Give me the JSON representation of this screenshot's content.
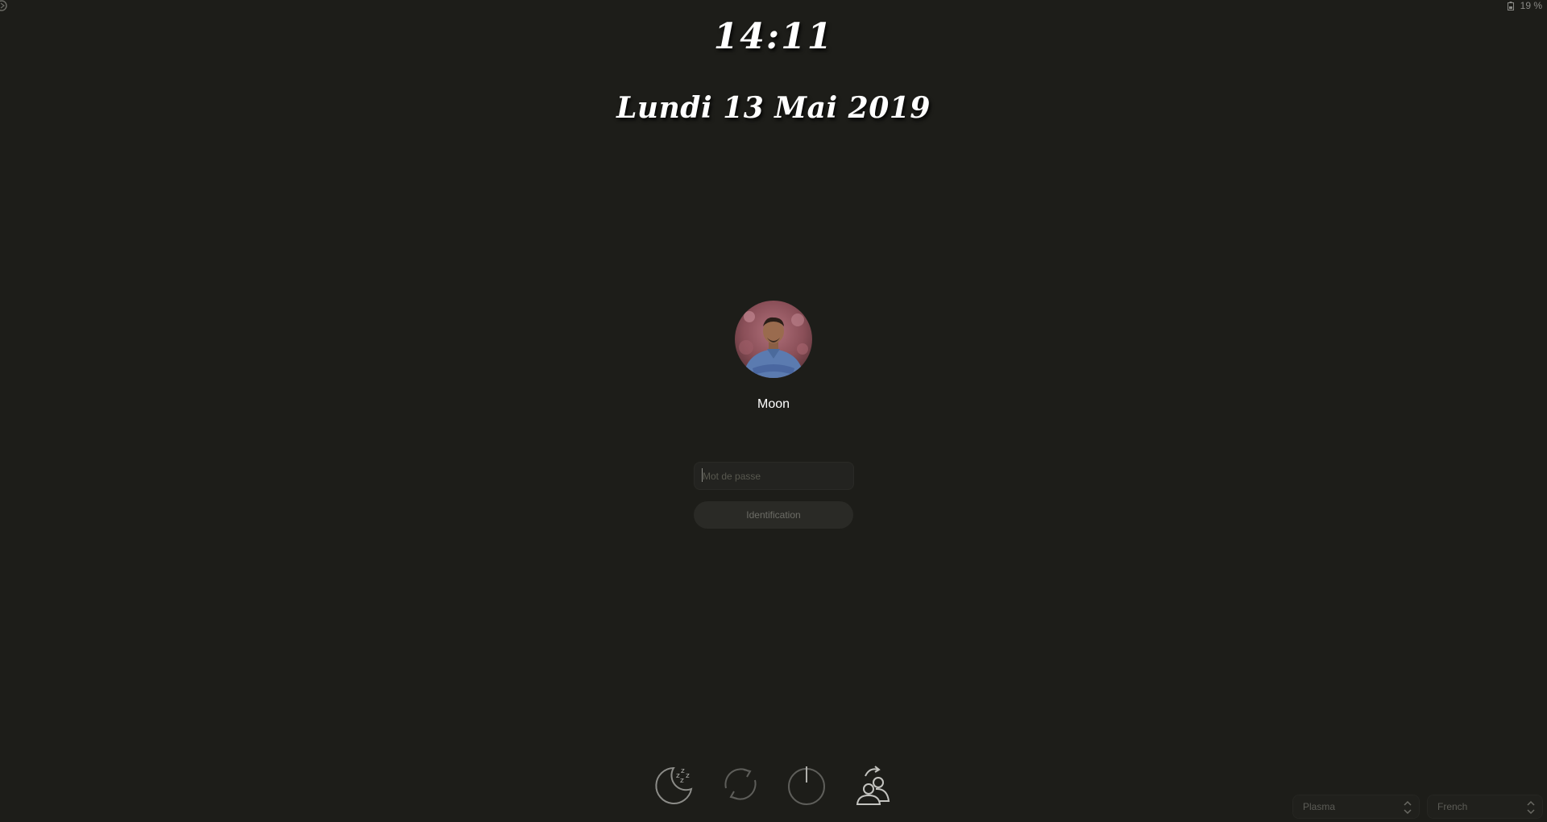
{
  "status": {
    "battery_text": "19 %",
    "battery_icon": "battery-icon"
  },
  "clock": {
    "time": "14:11"
  },
  "date": {
    "text": "Lundi 13 Mai 2019"
  },
  "user": {
    "name": "Moon",
    "avatar_icon": "user-avatar"
  },
  "login": {
    "password_placeholder": "Mot de passe",
    "password_value": "",
    "button_label": "Identification"
  },
  "actions": [
    {
      "name": "suspend",
      "icon": "sleep-moon-icon"
    },
    {
      "name": "restart",
      "icon": "restart-icon"
    },
    {
      "name": "shutdown",
      "icon": "power-icon"
    },
    {
      "name": "switch-user",
      "icon": "switch-user-icon"
    }
  ],
  "session": {
    "selected": "Plasma"
  },
  "keyboard": {
    "selected": "French"
  },
  "colors": {
    "background": "#1d1d19",
    "text": "#ffffff",
    "muted": "#6c6c66"
  }
}
